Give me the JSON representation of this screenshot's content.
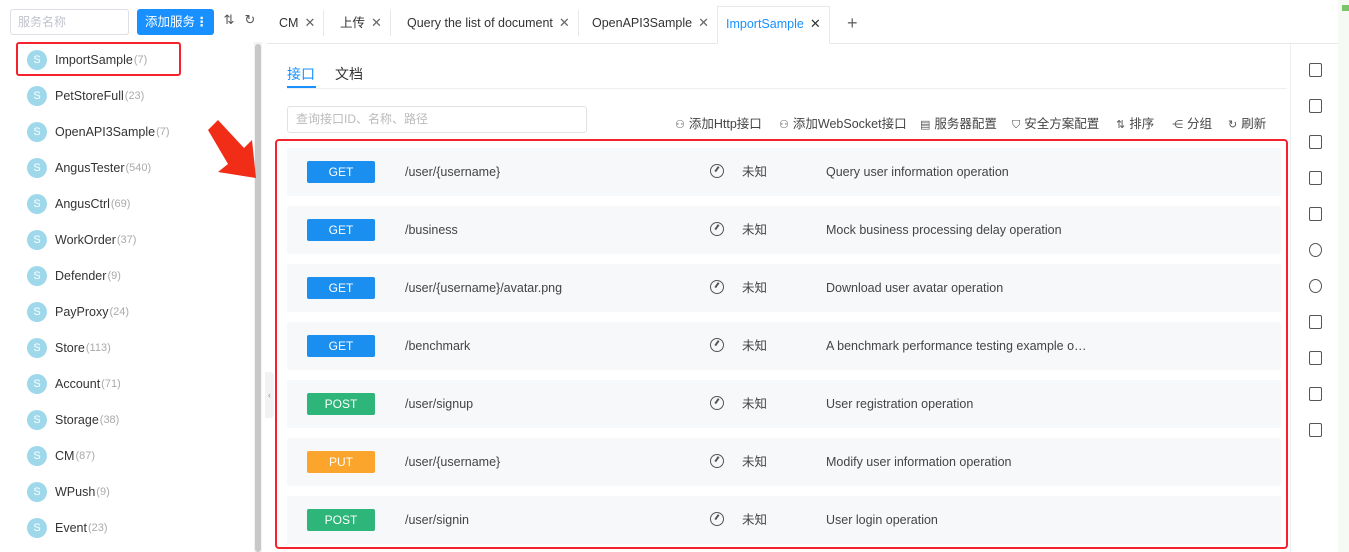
{
  "sidebar": {
    "search_placeholder": "服务名称",
    "add_button_label": "添加服务",
    "add_button_more": "⋮",
    "sort_icon_glyph": "⇅",
    "refresh_icon_glyph": "↻",
    "services": [
      {
        "avatar": "S",
        "name": "ImportSample",
        "count": "(7)"
      },
      {
        "avatar": "S",
        "name": "PetStoreFull",
        "count": "(23)"
      },
      {
        "avatar": "S",
        "name": "OpenAPI3Sample",
        "count": "(7)"
      },
      {
        "avatar": "S",
        "name": "AngusTester",
        "count": "(540)"
      },
      {
        "avatar": "S",
        "name": "AngusCtrl",
        "count": "(69)"
      },
      {
        "avatar": "S",
        "name": "WorkOrder",
        "count": "(37)"
      },
      {
        "avatar": "S",
        "name": "Defender",
        "count": "(9)"
      },
      {
        "avatar": "S",
        "name": "PayProxy",
        "count": "(24)"
      },
      {
        "avatar": "S",
        "name": "Store",
        "count": "(113)"
      },
      {
        "avatar": "S",
        "name": "Account",
        "count": "(71)"
      },
      {
        "avatar": "S",
        "name": "Storage",
        "count": "(38)"
      },
      {
        "avatar": "S",
        "name": "CM",
        "count": "(87)"
      },
      {
        "avatar": "S",
        "name": "WPush",
        "count": "(9)"
      },
      {
        "avatar": "S",
        "name": "Event",
        "count": "(23)"
      }
    ]
  },
  "tabs": [
    {
      "label": "CM",
      "close": "✕"
    },
    {
      "label": "上传",
      "close": "✕"
    },
    {
      "label": "Query the list of document",
      "close": "✕"
    },
    {
      "label": "OpenAPI3Sample",
      "close": "✕"
    },
    {
      "label": "ImportSample",
      "close": "✕",
      "active": true
    }
  ],
  "add_tab_glyph": "+",
  "subtabs": [
    {
      "label": "接口",
      "active": true
    },
    {
      "label": "文档",
      "active": false
    }
  ],
  "filter_placeholder": "查询接口ID、名称、路径",
  "actions": [
    {
      "icon": "http-icon",
      "glyph": "⚇",
      "label": "添加Http接口"
    },
    {
      "icon": "websocket-icon",
      "glyph": "⚇",
      "label": "添加WebSocket接口"
    },
    {
      "icon": "server-icon",
      "glyph": "▤",
      "label": "服务器配置"
    },
    {
      "icon": "shield-icon",
      "glyph": "⛉",
      "label": "安全方案配置"
    },
    {
      "icon": "sort-icon",
      "glyph": "⇅",
      "label": "排序"
    },
    {
      "icon": "group-icon",
      "glyph": "⋲",
      "label": "分组"
    },
    {
      "icon": "refresh-icon",
      "glyph": "↻",
      "label": "刷新"
    }
  ],
  "colors": {
    "get": "#1a8ff0",
    "post": "#2eb57a",
    "put": "#fba52c",
    "accent": "#1890ff",
    "highlight": "#f5222d"
  },
  "apis": [
    {
      "method": "GET",
      "path": "/user/{username}",
      "status": "未知",
      "desc": "Query user information operation"
    },
    {
      "method": "GET",
      "path": "/business",
      "status": "未知",
      "desc": "Mock business processing delay operation"
    },
    {
      "method": "GET",
      "path": "/user/{username}/avatar.png",
      "status": "未知",
      "desc": "Download user avatar operation"
    },
    {
      "method": "GET",
      "path": "/benchmark",
      "status": "未知",
      "desc": "A benchmark performance testing example o…"
    },
    {
      "method": "POST",
      "path": "/user/signup",
      "status": "未知",
      "desc": "User registration operation"
    },
    {
      "method": "PUT",
      "path": "/user/{username}",
      "status": "未知",
      "desc": "Modify user information operation"
    },
    {
      "method": "POST",
      "path": "/user/signin",
      "status": "未知",
      "desc": "User login operation"
    }
  ],
  "right_rail_icons": [
    "document-icon",
    "book-icon",
    "apps-icon",
    "shield-icon",
    "server-icon",
    "target-icon",
    "clock-icon",
    "code-icon",
    "bookmark-icon",
    "puzzle-icon",
    "mock-icon"
  ]
}
